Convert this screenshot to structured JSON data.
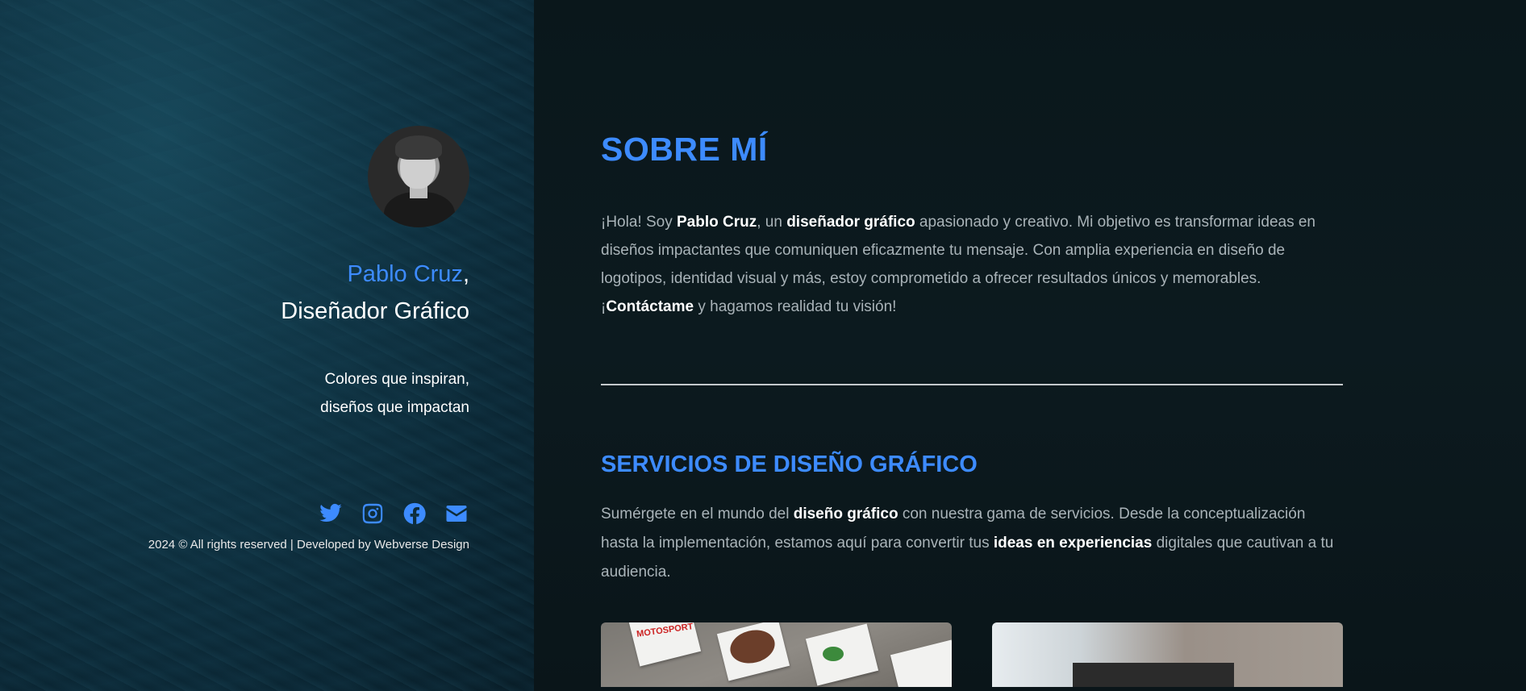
{
  "profile": {
    "name": "Pablo Cruz",
    "name_suffix": ",",
    "role": "Diseñador Gráfico",
    "tagline_line1": "Colores que inspiran,",
    "tagline_line2": "diseños que impactan",
    "footer": "2024 © All rights reserved | Developed by Webverse Design"
  },
  "socials": [
    {
      "icon": "twitter-icon"
    },
    {
      "icon": "instagram-icon"
    },
    {
      "icon": "facebook-icon"
    },
    {
      "icon": "envelope-icon"
    }
  ],
  "about": {
    "title": "SOBRE MÍ",
    "p1": "¡Hola! Soy ",
    "b1": "Pablo Cruz",
    "p2": ", un ",
    "b2": "diseñador gráfico",
    "p3": " apasionado y creativo. Mi objetivo es transformar ideas en diseños impactantes que comuniquen eficazmente tu mensaje. Con amplia experiencia en diseño de logotipos, identidad visual y más, estoy comprometido a ofrecer resultados únicos y memorables. ¡",
    "b3": "Contáctame",
    "p4": " y hagamos realidad tu visión!"
  },
  "services": {
    "title": "SERVICIOS DE DISEÑO GRÁFICO",
    "p1": "Sumérgete en el mundo del ",
    "b1": "diseño gráfico",
    "p2": " con nuestra gama de servicios. Desde la conceptualización hasta la implementación, estamos aquí para convertir tus ",
    "b2": "ideas en experiencias",
    "p3": " digitales que cautivan a tu audiencia.",
    "card1_mark": "MOTOSPORT"
  },
  "colors": {
    "accent": "#3d8bff",
    "text_muted": "#a9b3b8",
    "background": "#0b1519"
  }
}
